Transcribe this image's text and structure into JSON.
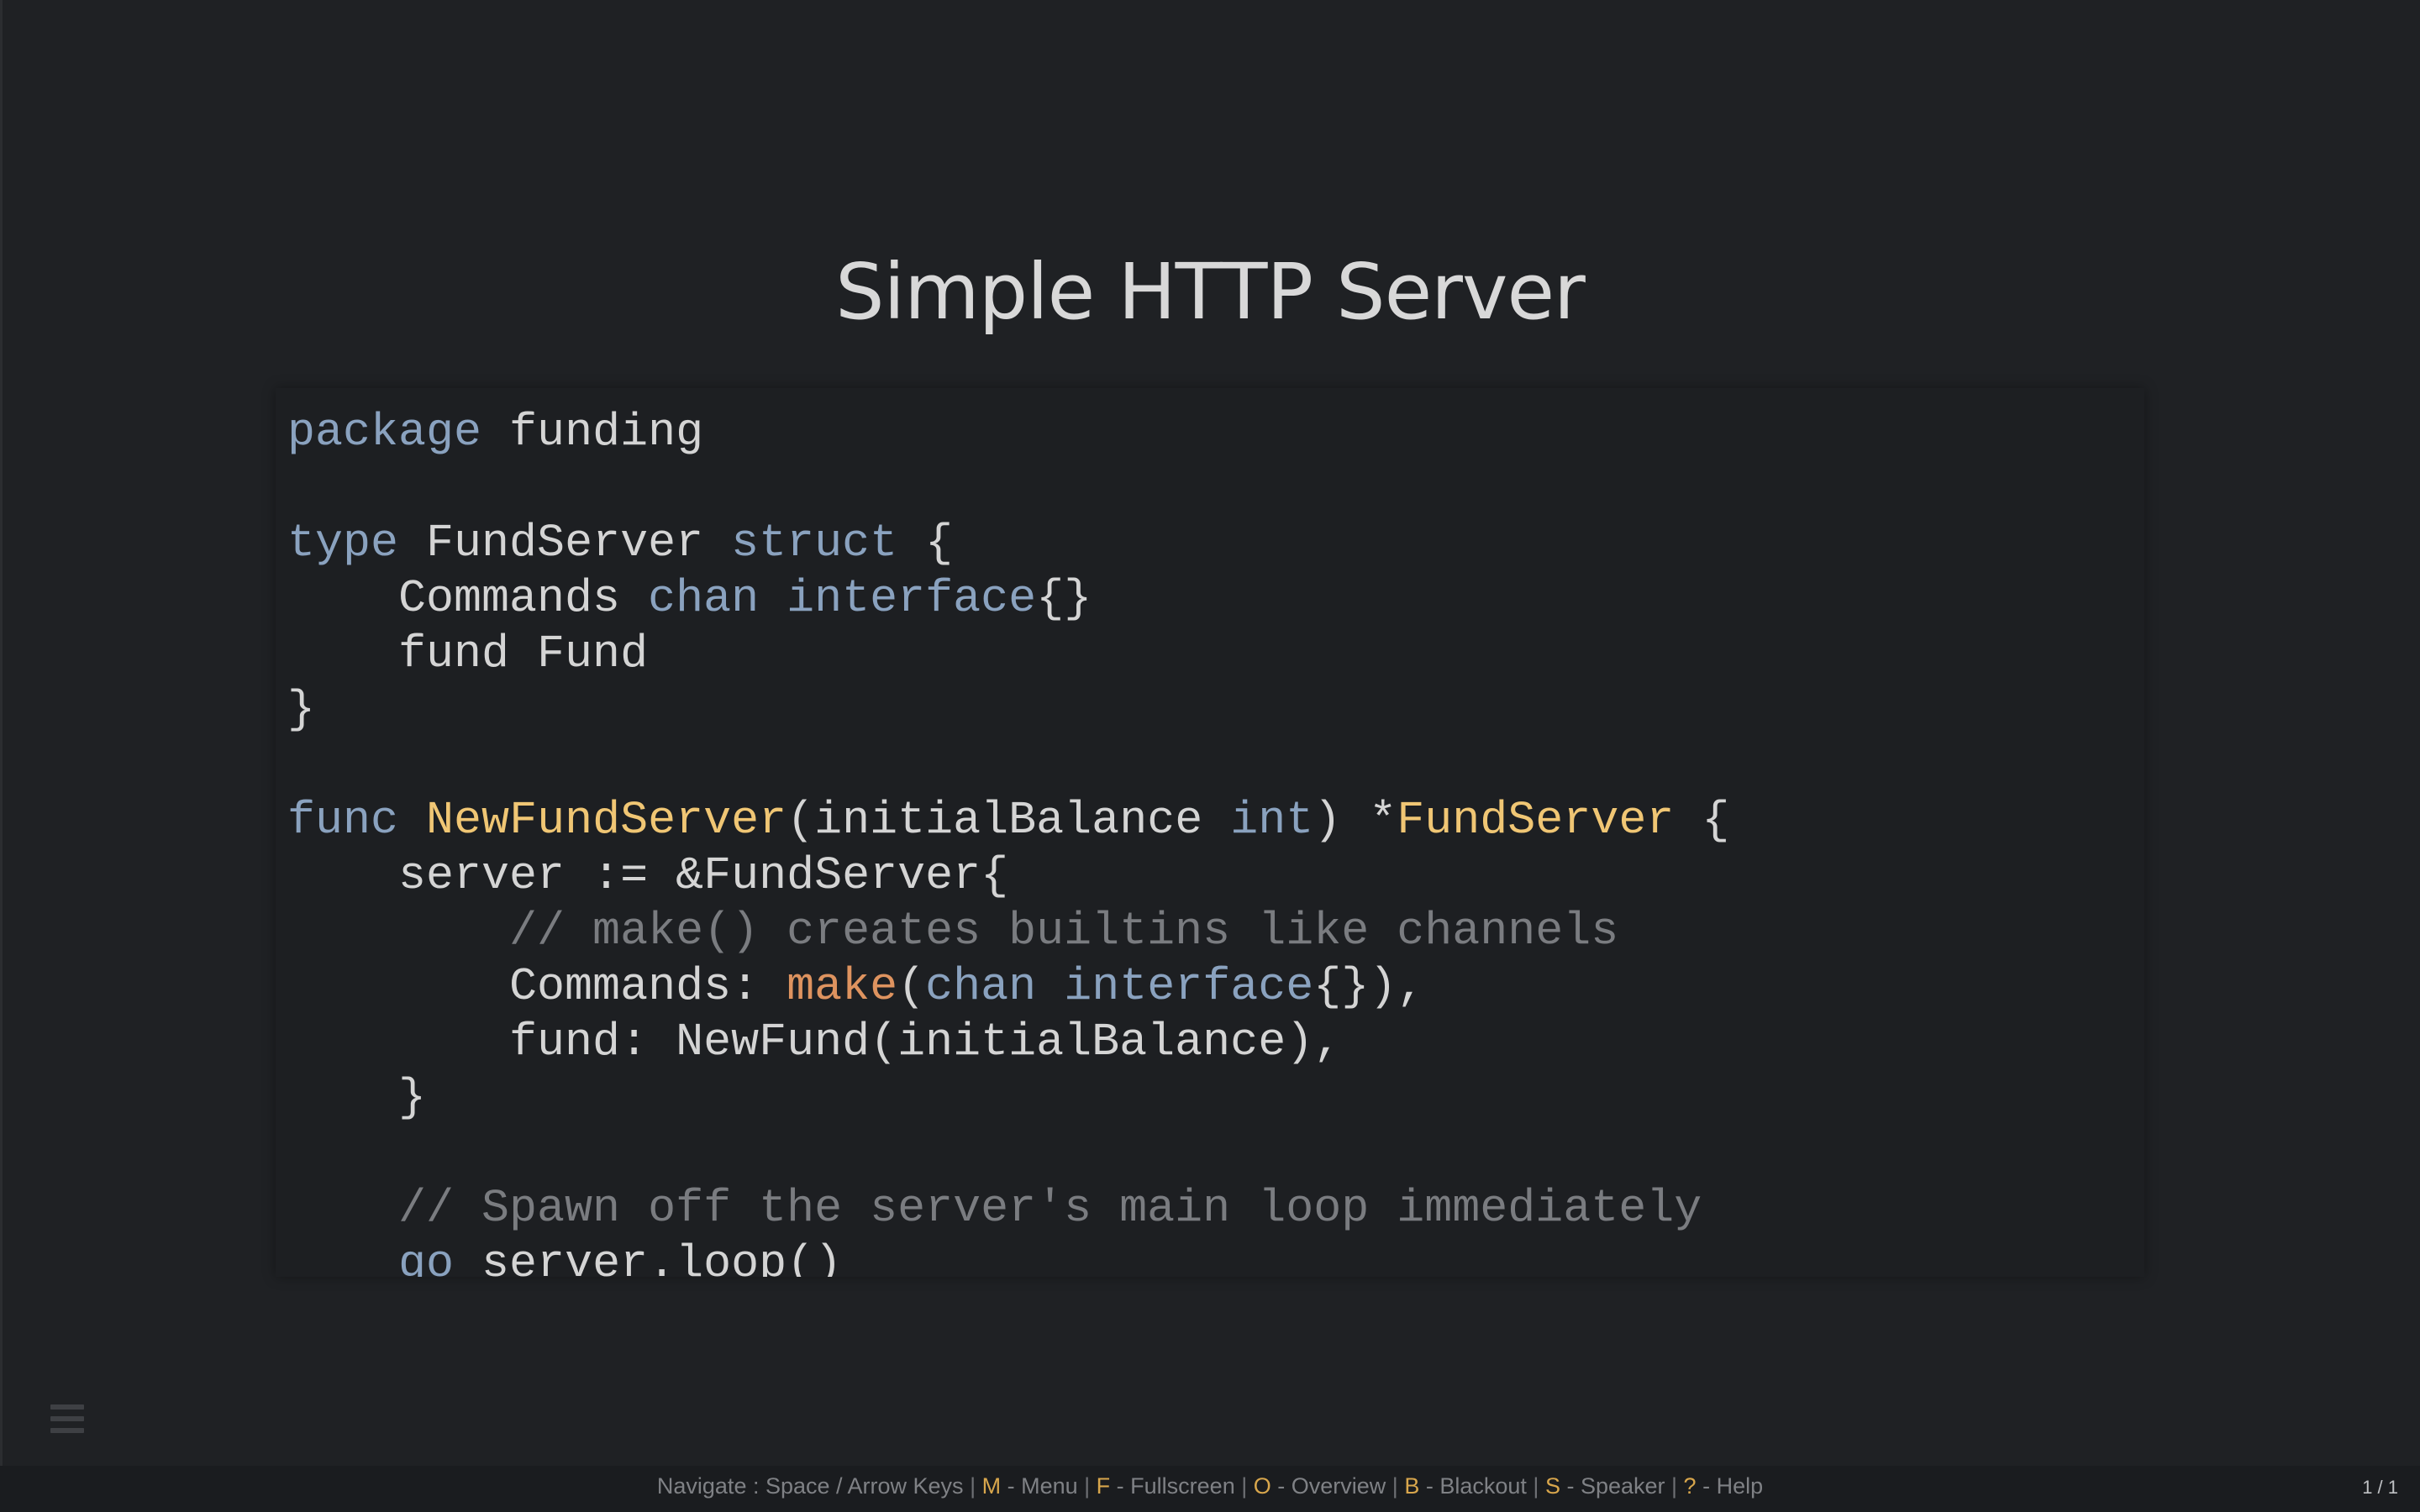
{
  "slide": {
    "title": "Simple HTTP Server",
    "number": "1 / 1"
  },
  "code": {
    "lines": [
      [
        {
          "t": "package",
          "c": "kw"
        },
        {
          "t": " funding",
          "c": "pl"
        }
      ],
      [],
      [
        {
          "t": "type",
          "c": "kw"
        },
        {
          "t": " FundServer ",
          "c": "pl"
        },
        {
          "t": "struct",
          "c": "kw"
        },
        {
          "t": " {",
          "c": "pl"
        }
      ],
      [
        {
          "t": "    Commands ",
          "c": "pl"
        },
        {
          "t": "chan",
          "c": "kw"
        },
        {
          "t": " ",
          "c": "pl"
        },
        {
          "t": "interface",
          "c": "kw"
        },
        {
          "t": "{}",
          "c": "pl"
        }
      ],
      [
        {
          "t": "    fund Fund",
          "c": "pl"
        }
      ],
      [
        {
          "t": "}",
          "c": "pl"
        }
      ],
      [],
      [
        {
          "t": "func",
          "c": "kw"
        },
        {
          "t": " ",
          "c": "pl"
        },
        {
          "t": "NewFundServer",
          "c": "fn"
        },
        {
          "t": "(initialBalance ",
          "c": "pl"
        },
        {
          "t": "int",
          "c": "kw"
        },
        {
          "t": ") *",
          "c": "pl"
        },
        {
          "t": "FundServer",
          "c": "fn"
        },
        {
          "t": " {",
          "c": "pl"
        }
      ],
      [
        {
          "t": "    server := &FundServer{",
          "c": "pl"
        }
      ],
      [
        {
          "t": "        // make() creates builtins like channels",
          "c": "cm"
        }
      ],
      [
        {
          "t": "        Commands: ",
          "c": "pl"
        },
        {
          "t": "make",
          "c": "bi"
        },
        {
          "t": "(",
          "c": "pl"
        },
        {
          "t": "chan",
          "c": "kw"
        },
        {
          "t": " ",
          "c": "pl"
        },
        {
          "t": "interface",
          "c": "kw"
        },
        {
          "t": "{}),",
          "c": "pl"
        }
      ],
      [
        {
          "t": "        fund: NewFund(initialBalance),",
          "c": "pl"
        }
      ],
      [
        {
          "t": "    }",
          "c": "pl"
        }
      ],
      [],
      [
        {
          "t": "    // Spawn off the server's main loop immediately",
          "c": "cm"
        }
      ],
      [
        {
          "t": "    ",
          "c": "pl"
        },
        {
          "t": "go",
          "c": "kw"
        },
        {
          "t": " server.loop()",
          "c": "pl"
        }
      ]
    ]
  },
  "help_bar": {
    "items": [
      {
        "key": "",
        "text": "Navigate : Space / Arrow Keys"
      },
      {
        "key": "M",
        "text": " - Menu"
      },
      {
        "key": "F",
        "text": " - Fullscreen"
      },
      {
        "key": "O",
        "text": " - Overview"
      },
      {
        "key": "B",
        "text": " - Blackout"
      },
      {
        "key": "S",
        "text": " - Speaker"
      },
      {
        "key": "?",
        "text": " - Help"
      }
    ]
  },
  "icons": {
    "menu": "hamburger-menu-icon"
  },
  "colors": {
    "background": "#1f2124",
    "keyword": "#8aa2bf",
    "function_name": "#f0c674",
    "builtin": "#de935f",
    "comment": "#7a7c80",
    "help_key": "#d8a64c"
  }
}
